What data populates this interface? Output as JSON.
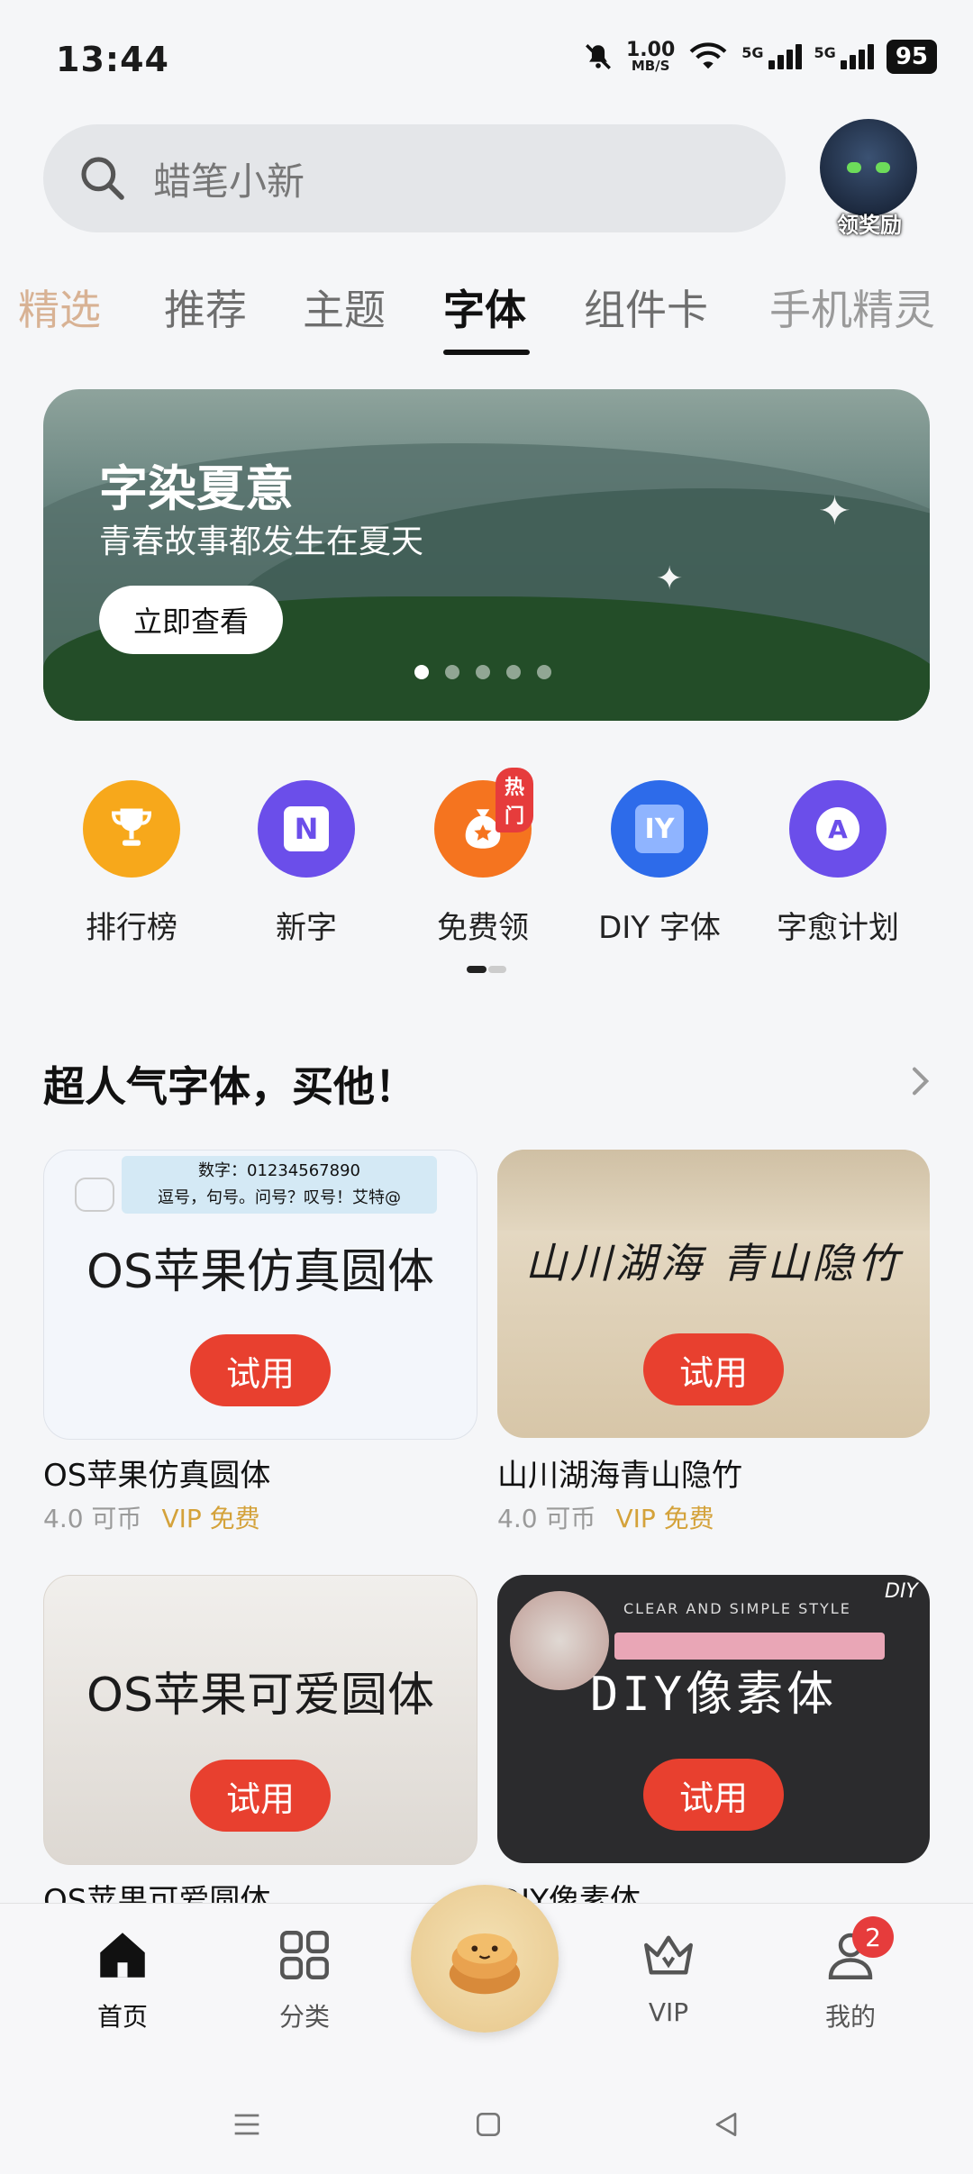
{
  "status": {
    "time": "13:44",
    "speed_value": "1.00",
    "speed_unit": "MB/S",
    "sim1": "5G",
    "sim2": "5G",
    "battery": "95"
  },
  "search": {
    "placeholder": "蜡笔小新"
  },
  "avatar": {
    "reward_label": "领奖励"
  },
  "tabs": [
    {
      "label": "精选"
    },
    {
      "label": "推荐"
    },
    {
      "label": "主题"
    },
    {
      "label": "字体",
      "active": true
    },
    {
      "label": "组件卡"
    },
    {
      "label": "手机精灵"
    }
  ],
  "banner": {
    "title": "字染夏意",
    "subtitle": "青春故事都发生在夏天",
    "button": "立即查看",
    "page_count": 5,
    "current_page": 1
  },
  "quick": [
    {
      "label": "排行榜",
      "icon": "trophy-icon",
      "color": "#f7a81b"
    },
    {
      "label": "新字",
      "icon": "n-icon",
      "color": "#6b4eea"
    },
    {
      "label": "免费领",
      "icon": "moneybag-icon",
      "color": "#f5741f",
      "tag": "热门"
    },
    {
      "label": "DIY 字体",
      "icon": "diy-icon",
      "color": "#2d6bea"
    },
    {
      "label": "字愈计划",
      "icon": "a-icon",
      "color": "#6b4eea"
    }
  ],
  "section": {
    "title": "超人气字体，买他！"
  },
  "fonts": [
    {
      "preview": "OS苹果仿真圆体",
      "name": "OS苹果仿真圆体",
      "price": "4.0 可币",
      "vip": "VIP 免费",
      "try": "试用",
      "sample_line1": "数字：01234567890",
      "sample_line2": "逗号，句号。问号？叹号！艾特@"
    },
    {
      "preview": "山川湖海 青山隐竹",
      "name": "山川湖海青山隐竹",
      "price": "4.0 可币",
      "vip": "VIP 免费",
      "try": "试用"
    },
    {
      "preview": "OS苹果可爱圆体",
      "name": "OS苹果可爱圆体",
      "try": "试用"
    },
    {
      "preview": "DIY像素体",
      "name": "DIY像素体",
      "try": "试用",
      "deco": "CLEAR AND SIMPLE STYLE",
      "corner": "DIY"
    }
  ],
  "nav": [
    {
      "label": "首页",
      "icon": "home-icon",
      "active": true
    },
    {
      "label": "分类",
      "icon": "grid-icon"
    },
    {
      "label": "",
      "icon": "center-mascot-icon"
    },
    {
      "label": "VIP",
      "icon": "crown-icon"
    },
    {
      "label": "我的",
      "icon": "profile-icon",
      "badge": "2"
    }
  ]
}
